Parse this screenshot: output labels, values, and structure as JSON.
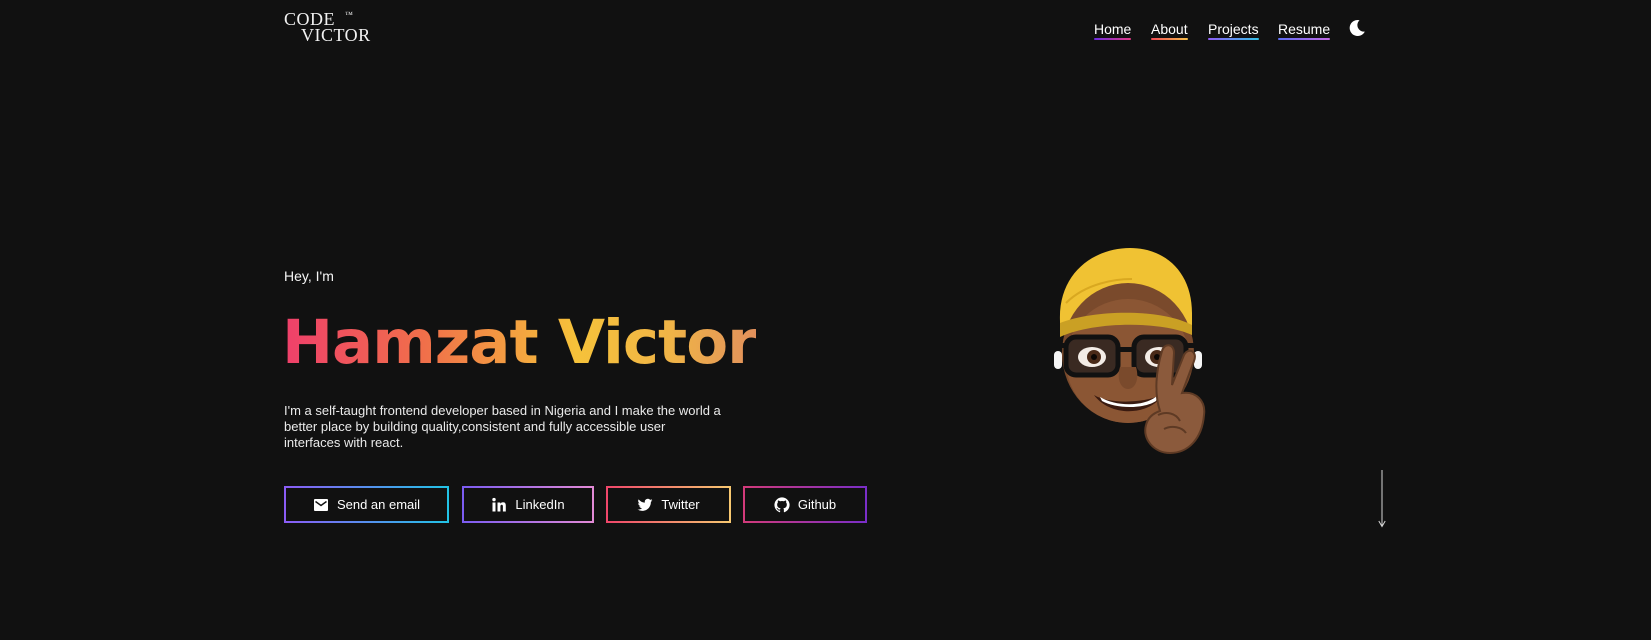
{
  "logo": {
    "line1": "CODE",
    "tm": "™",
    "line2": "VICTOR"
  },
  "nav": {
    "items": [
      {
        "label": "Home"
      },
      {
        "label": "About"
      },
      {
        "label": "Projects"
      },
      {
        "label": "Resume"
      }
    ],
    "underline_gradients": [
      [
        "#6b2de0",
        "#e33a86"
      ],
      [
        "#f24a55",
        "#f5c04a"
      ],
      [
        "#8e5cf6",
        "#34c3e8"
      ],
      [
        "#5c6cf2",
        "#c46ae6"
      ]
    ],
    "theme_toggle_icon": "moon-icon"
  },
  "hero": {
    "greeting": "Hey, I'm",
    "name": "Hamzat Victor",
    "bio": "I'm a self-taught frontend developer based in Nigeria and I make the world a better place by building quality,consistent and fully accessible user interfaces with react."
  },
  "buttons": [
    {
      "label": "Send an email",
      "icon": "mail-icon",
      "border_colors": [
        "#8b5cf6",
        "#22c3e6"
      ]
    },
    {
      "label": "LinkedIn",
      "icon": "linkedin-icon",
      "border_colors": [
        "#7c5cf2",
        "#e38ad6"
      ]
    },
    {
      "label": "Twitter",
      "icon": "twitter-icon",
      "border_colors": [
        "#f0466a",
        "#f7c870"
      ]
    },
    {
      "label": "Github",
      "icon": "github-icon",
      "border_colors": [
        "#d23a7a",
        "#7a2ec8"
      ]
    }
  ],
  "colors": {
    "background": "#111111",
    "text": "#ffffff",
    "name_gradient": [
      "#ef3f6b",
      "#f06f4a",
      "#f6c23a",
      "#e1905c"
    ]
  },
  "avatar": {
    "icon": "memoji-avatar"
  },
  "scroll": {
    "icon": "arrow-down-icon"
  }
}
